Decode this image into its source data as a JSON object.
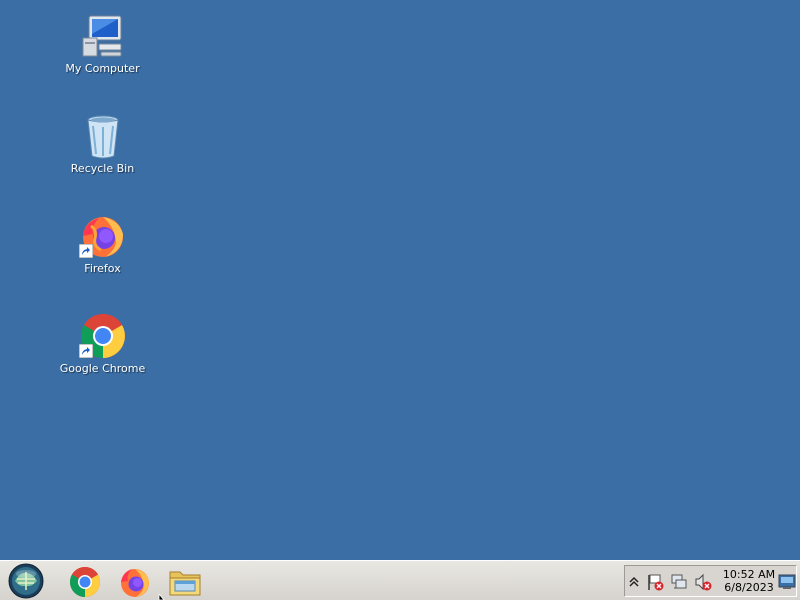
{
  "desktop": {
    "background_color": "#3a6ea5",
    "icons": [
      {
        "label": "My Computer",
        "icon": "computer-icon"
      },
      {
        "label": "Recycle Bin",
        "icon": "recycle-bin-icon"
      },
      {
        "label": "Firefox",
        "icon": "firefox-icon",
        "shortcut": true
      },
      {
        "label": "Google Chrome",
        "icon": "chrome-icon",
        "shortcut": true
      }
    ]
  },
  "taskbar": {
    "start_icon": "start-orb-icon",
    "pinned_apps": [
      {
        "icon": "chrome-icon"
      },
      {
        "icon": "firefox-icon"
      },
      {
        "icon": "file-explorer-icon"
      }
    ],
    "tray": {
      "icons": [
        "show-hidden-icons-chevron",
        "action-center-flag-icon",
        "network-disconnected-icon",
        "volume-muted-icon"
      ],
      "time": "10:52 AM",
      "date": "6/8/2023"
    }
  }
}
